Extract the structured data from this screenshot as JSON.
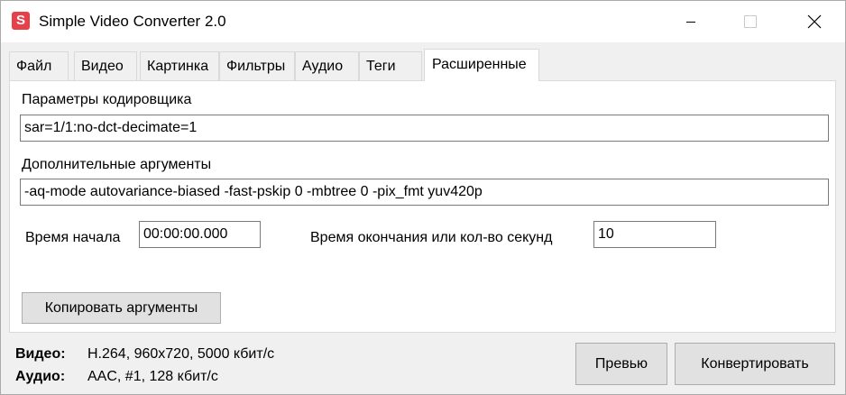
{
  "window": {
    "app_icon_letter": "S",
    "title": "Simple Video Converter 2.0",
    "minimize_glyph": "minimize-icon",
    "maximize_glyph": "maximize-icon",
    "close_glyph": "close-icon"
  },
  "tabs": [
    {
      "label": "Файл"
    },
    {
      "label": "Видео"
    },
    {
      "label": "Картинка"
    },
    {
      "label": "Фильтры"
    },
    {
      "label": "Аудио"
    },
    {
      "label": "Теги"
    },
    {
      "label": "Расширенные",
      "active": true
    }
  ],
  "advanced": {
    "encoder_params_label": "Параметры кодировщика",
    "encoder_params_value": "sar=1/1:no-dct-decimate=1",
    "extra_args_label": "Дополнительные аргументы",
    "extra_args_value": "-aq-mode autovariance-biased -fast-pskip 0 -mbtree 0 -pix_fmt yuv420p",
    "start_time_label": "Время начала",
    "start_time_value": "00:00:00.000",
    "end_time_label": "Время окончания или кол-во секунд",
    "end_time_value": "10",
    "copy_args_label": "Копировать аргументы"
  },
  "status": {
    "video_key": "Видео:",
    "video_value": "H.264, 960x720, 5000 кбит/с",
    "audio_key": "Аудио:",
    "audio_value": "AAC, #1, 128 кбит/с"
  },
  "actions": {
    "preview_label": "Превью",
    "convert_label": "Конвертировать"
  }
}
